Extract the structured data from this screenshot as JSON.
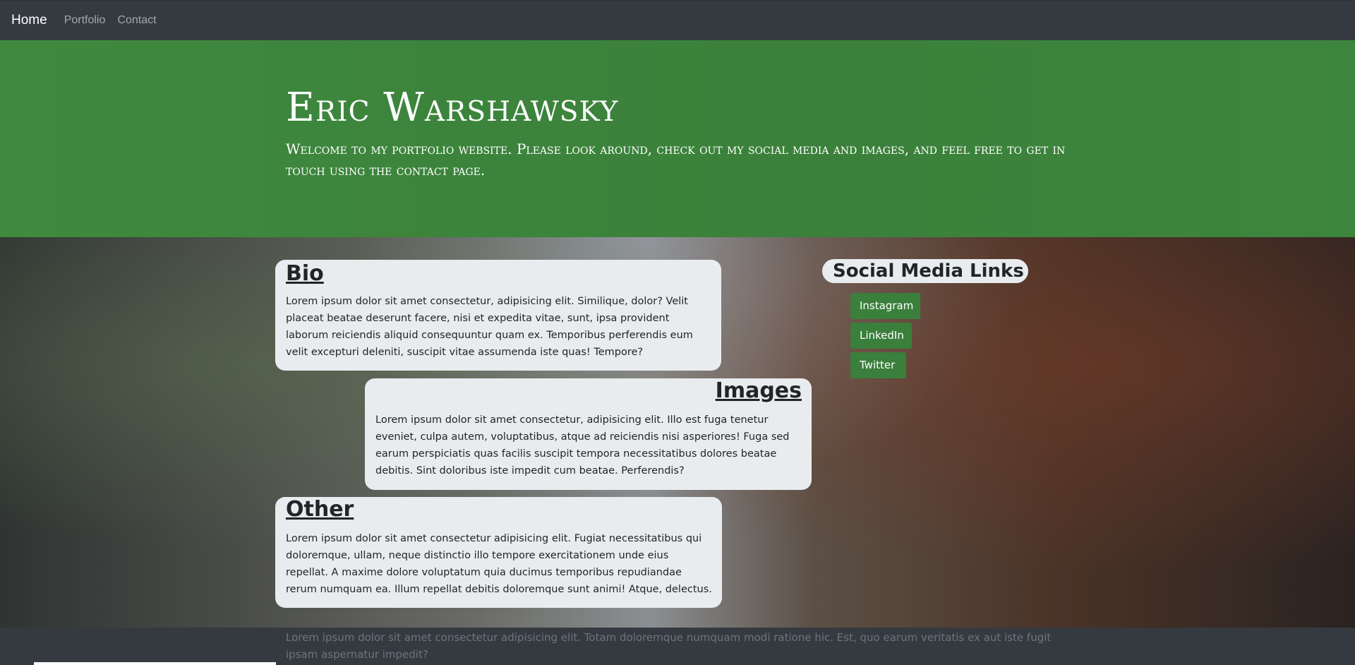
{
  "nav": {
    "home": "Home",
    "portfolio": "Portfolio",
    "contact": "Contact"
  },
  "hero": {
    "title": "Eric Warshawsky",
    "subtitle": "Welcome to my portfolio website. Please look around, check out my social media and images, and feel free to get in touch using the contact page."
  },
  "sections": {
    "bio": {
      "heading": "Bio",
      "text": "Lorem ipsum dolor sit amet consectetur, adipisicing elit. Similique, dolor? Velit placeat beatae deserunt facere, nisi et expedita vitae, sunt, ipsa provident laborum reiciendis aliquid consequuntur quam ex. Temporibus perferendis eum velit excepturi deleniti, suscipit vitae assumenda iste quas! Tempore?"
    },
    "images": {
      "heading": "Images",
      "text": "Lorem ipsum dolor sit amet consectetur, adipisicing elit. Illo est fuga tenetur eveniet, culpa autem, voluptatibus, atque ad reiciendis nisi asperiores! Fuga sed earum perspiciatis quas facilis suscipit tempora necessitatibus dolores beatae debitis. Sint doloribus iste impedit cum beatae. Perferendis?"
    },
    "other": {
      "heading": "Other",
      "text": "Lorem ipsum dolor sit amet consectetur adipisicing elit. Fugiat necessitatibus qui doloremque, ullam, neque distinctio illo tempore exercitationem unde eius repellat. A maxime dolore voluptatum quia ducimus temporibus repudiandae rerum numquam ea. Illum repellat debitis doloremque sunt animi! Atque, delectus."
    }
  },
  "social": {
    "title": "Social Media Links",
    "instagram": "Instagram",
    "linkedin": "LinkedIn",
    "twitter": "Twitter"
  },
  "footer": {
    "text": "Lorem ipsum dolor sit amet consectetur adipisicing elit. Totam doloremque numquam modi ratione hic. Est, quo earum veritatis ex aut iste fugit ipsam aspernatur impedit?"
  },
  "colors": {
    "navbar": "#343a40",
    "hero": "#3f8a3f",
    "button": "#3a7f3b",
    "card": "#e9ecef"
  }
}
